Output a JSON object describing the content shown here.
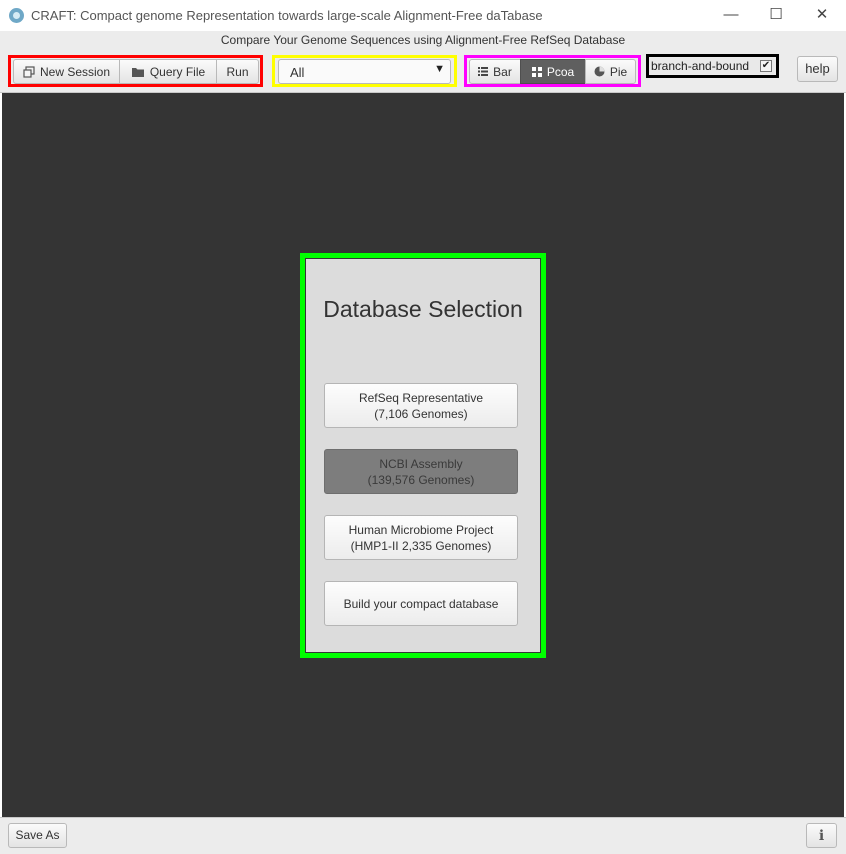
{
  "window": {
    "title": "CRAFT: Compact genome Representation towards large-scale Alignment-Free daTabase",
    "controls": {
      "minimize": "—",
      "maximize": "☐",
      "close": "✕"
    }
  },
  "header": {
    "subtitle": "Compare Your Genome Sequences using Alignment-Free RefSeq Database"
  },
  "toolbar": {
    "new_session": "New Session",
    "query_file": "Query File",
    "run": "Run",
    "filter_select": {
      "value": "All"
    },
    "views": [
      {
        "label": "Bar",
        "icon": "list-icon",
        "selected": false
      },
      {
        "label": "Pcoa",
        "icon": "grid-icon",
        "selected": true
      },
      {
        "label": "Pie",
        "icon": "pie-chart-icon",
        "selected": false
      }
    ],
    "branch_and_bound": {
      "label": "branch-and-bound",
      "checked": true
    },
    "help": "help"
  },
  "database_selection": {
    "title": "Database Selection",
    "options": [
      {
        "line1": "RefSeq Representative",
        "line2": "(7,106 Genomes)",
        "disabled": false
      },
      {
        "line1": "NCBI Assembly",
        "line2": "(139,576 Genomes)",
        "disabled": true
      },
      {
        "line1": "Human Microbiome Project",
        "line2": "(HMP1-II 2,335 Genomes)",
        "disabled": false
      },
      {
        "line1": "Build your compact database",
        "line2": "",
        "disabled": false
      }
    ]
  },
  "footer": {
    "save_as": "Save As",
    "info_icon": "ℹ"
  },
  "colors": {
    "highlight_red": "#ff0000",
    "highlight_yellow": "#ffff00",
    "highlight_magenta": "#ff00ff",
    "highlight_black": "#000000",
    "highlight_green": "#00ff00",
    "canvas": "#343434",
    "selected_toggle": "#5f5f5f"
  }
}
